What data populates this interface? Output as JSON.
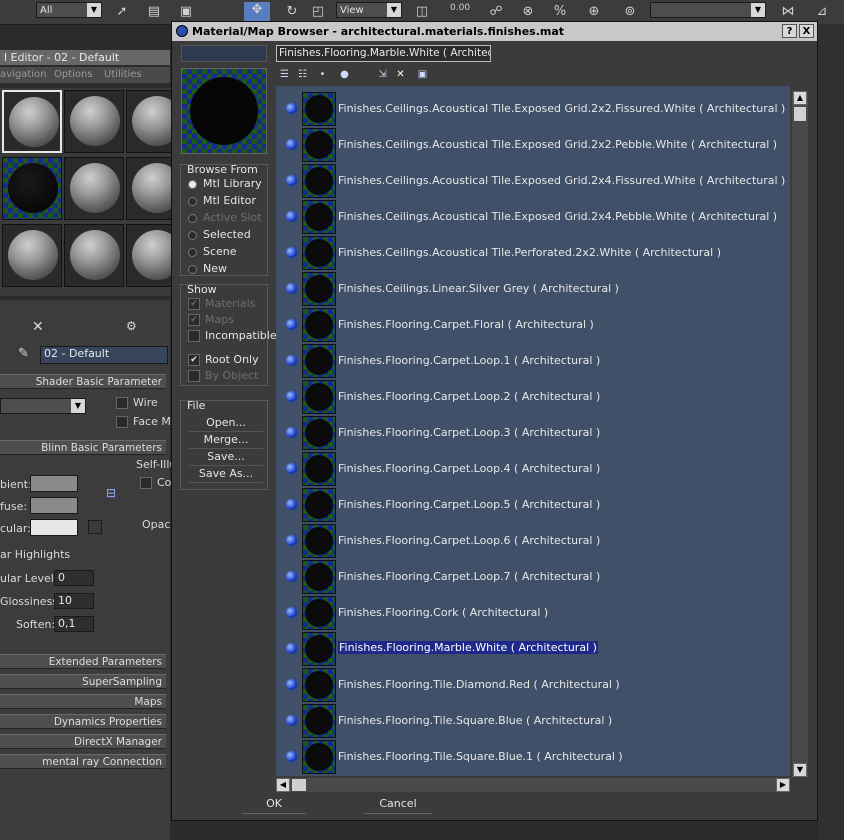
{
  "toolbar": {
    "selection_filter": "All",
    "reference_coord": "View",
    "numeric_display": "0.00"
  },
  "material_editor": {
    "title": "l Editor - 02 - Default",
    "menu": [
      "avigation",
      "Options",
      "Utilities"
    ],
    "material_name": "02 - Default",
    "rollouts": {
      "shader_basic": "Shader Basic Parameter",
      "wire": "Wire",
      "face_map": "Face M",
      "blinn_basic": "Blinn Basic Parameters",
      "self_illum": "Self-Illu",
      "color_short": "Col",
      "ambient": "bient:",
      "diffuse": "fuse:",
      "specular": "cular:",
      "opacity_short": "Opac",
      "spec_highlights": "ar Highlights",
      "spec_level_label": "ular Level:",
      "spec_level_value": "0",
      "glossiness_label": "Glossiness:",
      "glossiness_value": "10",
      "soften_label": "Soften:",
      "soften_value": "0,1",
      "bottom": [
        "Extended Parameters",
        "SuperSampling",
        "Maps",
        "Dynamics Properties",
        "DirectX Manager",
        "mental ray Connection"
      ]
    }
  },
  "browser": {
    "title": "Material/Map Browser - architectural.materials.finishes.mat",
    "title_buttons": [
      "?",
      "X"
    ],
    "path": "Finishes.Flooring.Marble.White  ( Architectura",
    "browse_from": {
      "label": "Browse From",
      "options": [
        "Mtl Library",
        "Mtl Editor",
        "Active Slot",
        "Selected",
        "Scene",
        "New"
      ],
      "selected_index": 0
    },
    "show": {
      "label": "Show",
      "options": [
        "Materials",
        "Maps",
        "Incompatible"
      ],
      "root_only": "Root Only",
      "by_object": "By Object"
    },
    "file": {
      "label": "File",
      "buttons": [
        "Open...",
        "Merge...",
        "Save...",
        "Save As..."
      ]
    },
    "items": [
      "Finishes.Ceilings.Acoustical Tile.Exposed Grid.2x2.Fissured.White  ( Architectural )",
      "Finishes.Ceilings.Acoustical Tile.Exposed Grid.2x2.Pebble.White  ( Architectural )",
      "Finishes.Ceilings.Acoustical Tile.Exposed Grid.2x4.Fissured.White  ( Architectural )",
      "Finishes.Ceilings.Acoustical Tile.Exposed Grid.2x4.Pebble.White  ( Architectural )",
      "Finishes.Ceilings.Acoustical Tile.Perforated.2x2.White  ( Architectural )",
      "Finishes.Ceilings.Linear.Silver Grey  ( Architectural )",
      "Finishes.Flooring.Carpet.Floral  ( Architectural )",
      "Finishes.Flooring.Carpet.Loop.1  ( Architectural )",
      "Finishes.Flooring.Carpet.Loop.2  ( Architectural )",
      "Finishes.Flooring.Carpet.Loop.3  ( Architectural )",
      "Finishes.Flooring.Carpet.Loop.4  ( Architectural )",
      "Finishes.Flooring.Carpet.Loop.5  ( Architectural )",
      "Finishes.Flooring.Carpet.Loop.6  ( Architectural )",
      "Finishes.Flooring.Carpet.Loop.7  ( Architectural )",
      "Finishes.Flooring.Cork  ( Architectural )",
      "Finishes.Flooring.Marble.White  ( Architectural )",
      "Finishes.Flooring.Tile.Diamond.Red  ( Architectural )",
      "Finishes.Flooring.Tile.Square.Blue  ( Architectural )",
      "Finishes.Flooring.Tile.Square.Blue.1  ( Architectural )"
    ],
    "selected_item_index": 15,
    "ok": "OK",
    "cancel": "Cancel"
  }
}
